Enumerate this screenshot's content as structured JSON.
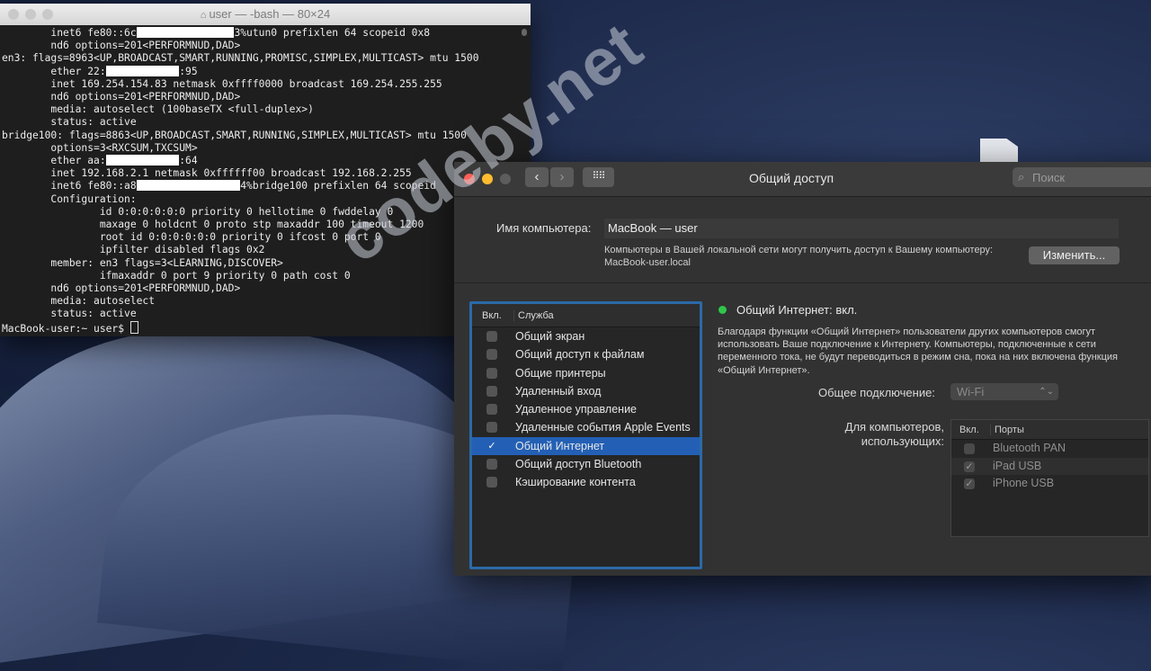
{
  "terminal": {
    "title": "user — -bash — 80×24",
    "lines": [
      [
        "        inet6 fe80::6c",
        {
          "redact": 16
        },
        "3%utun0 prefixlen 64 scopeid 0x8"
      ],
      [
        "        nd6 options=201<PERFORMNUD,DAD>"
      ],
      [
        "en3: flags=8963<UP,BROADCAST,SMART,RUNNING,PROMISC,SIMPLEX,MULTICAST> mtu 1500"
      ],
      [
        "        ether 22:",
        {
          "redact": 12
        },
        ":95"
      ],
      [
        "        inet 169.254.154.83 netmask 0xffff0000 broadcast 169.254.255.255"
      ],
      [
        "        nd6 options=201<PERFORMNUD,DAD>"
      ],
      [
        "        media: autoselect (100baseTX <full-duplex>)"
      ],
      [
        "        status: active"
      ],
      [
        "bridge100: flags=8863<UP,BROADCAST,SMART,RUNNING,SIMPLEX,MULTICAST> mtu 1500"
      ],
      [
        "        options=3<RXCSUM,TXCSUM>"
      ],
      [
        "        ether aa:",
        {
          "redact": 12
        },
        ":64"
      ],
      [
        "        inet 192.168.2.1 netmask 0xffffff00 broadcast 192.168.2.255"
      ],
      [
        "        inet6 fe80::a8",
        {
          "redact": 17
        },
        "4%bridge100 prefixlen 64 scopeid"
      ],
      [
        "        Configuration:"
      ],
      [
        "                id 0:0:0:0:0:0 priority 0 hellotime 0 fwddelay 0"
      ],
      [
        "                maxage 0 holdcnt 0 proto stp maxaddr 100 timeout 1200"
      ],
      [
        "                root id 0:0:0:0:0:0 priority 0 ifcost 0 port 0"
      ],
      [
        "                ipfilter disabled flags 0x2"
      ],
      [
        "        member: en3 flags=3<LEARNING,DISCOVER>"
      ],
      [
        "                ifmaxaddr 0 port 9 priority 0 path cost 0"
      ],
      [
        "        nd6 options=201<PERFORMNUD,DAD>"
      ],
      [
        "        media: autoselect"
      ],
      [
        "        status: active"
      ],
      [
        "MacBook-user:~ user$ ",
        {
          "cursor": true
        }
      ]
    ]
  },
  "prefs": {
    "title": "Общий доступ",
    "back_icon": "chevron-left",
    "forward_icon": "chevron-right",
    "grid_icon": "grid",
    "search": {
      "placeholder": "Поиск"
    },
    "computer_name_label": "Имя компьютера:",
    "computer_name_value": "MacBook — user",
    "computer_name_desc": "Компьютеры в Вашей локальной сети могут получить доступ к Вашему компьютеру: MacBook-user.local",
    "change_button": "Изменить...",
    "services": {
      "col_on": "Вкл.",
      "col_service": "Служба",
      "items": [
        {
          "label": "Общий экран",
          "checked": false,
          "selected": false
        },
        {
          "label": "Общий доступ к файлам",
          "checked": false,
          "selected": false
        },
        {
          "label": "Общие принтеры",
          "checked": false,
          "selected": false
        },
        {
          "label": "Удаленный вход",
          "checked": false,
          "selected": false
        },
        {
          "label": "Удаленное управление",
          "checked": false,
          "selected": false
        },
        {
          "label": "Удаленные события Apple Events",
          "checked": false,
          "selected": false
        },
        {
          "label": "Общий Интернет",
          "checked": true,
          "selected": true
        },
        {
          "label": "Общий доступ Bluetooth",
          "checked": false,
          "selected": false
        },
        {
          "label": "Кэширование контента",
          "checked": false,
          "selected": false
        }
      ]
    },
    "status": {
      "text": "Общий Интернет: вкл.",
      "color": "#2fc54a"
    },
    "info_text": "Благодаря функции «Общий Интернет» пользователи других компьютеров смогут использовать Ваше подключение к Интернету. Компьютеры, подключенные к сети переменного тока, не будут переводиться в режим сна, пока на них включена функция «Общий Интернет».",
    "share_label": "Общее подключение:",
    "share_value": "Wi-Fi",
    "for_label_1": "Для компьютеров,",
    "for_label_2": "использующих:",
    "ports": {
      "col_on": "Вкл.",
      "col_ports": "Порты",
      "items": [
        {
          "label": "Bluetooth PAN",
          "checked": false
        },
        {
          "label": "iPad USB",
          "checked": true
        },
        {
          "label": "iPhone USB",
          "checked": true
        }
      ]
    }
  },
  "watermark": "codeby.net",
  "colors": {
    "selection": "#2360b5",
    "focus_ring": "#2b6aa8",
    "status_green": "#2fc54a"
  }
}
